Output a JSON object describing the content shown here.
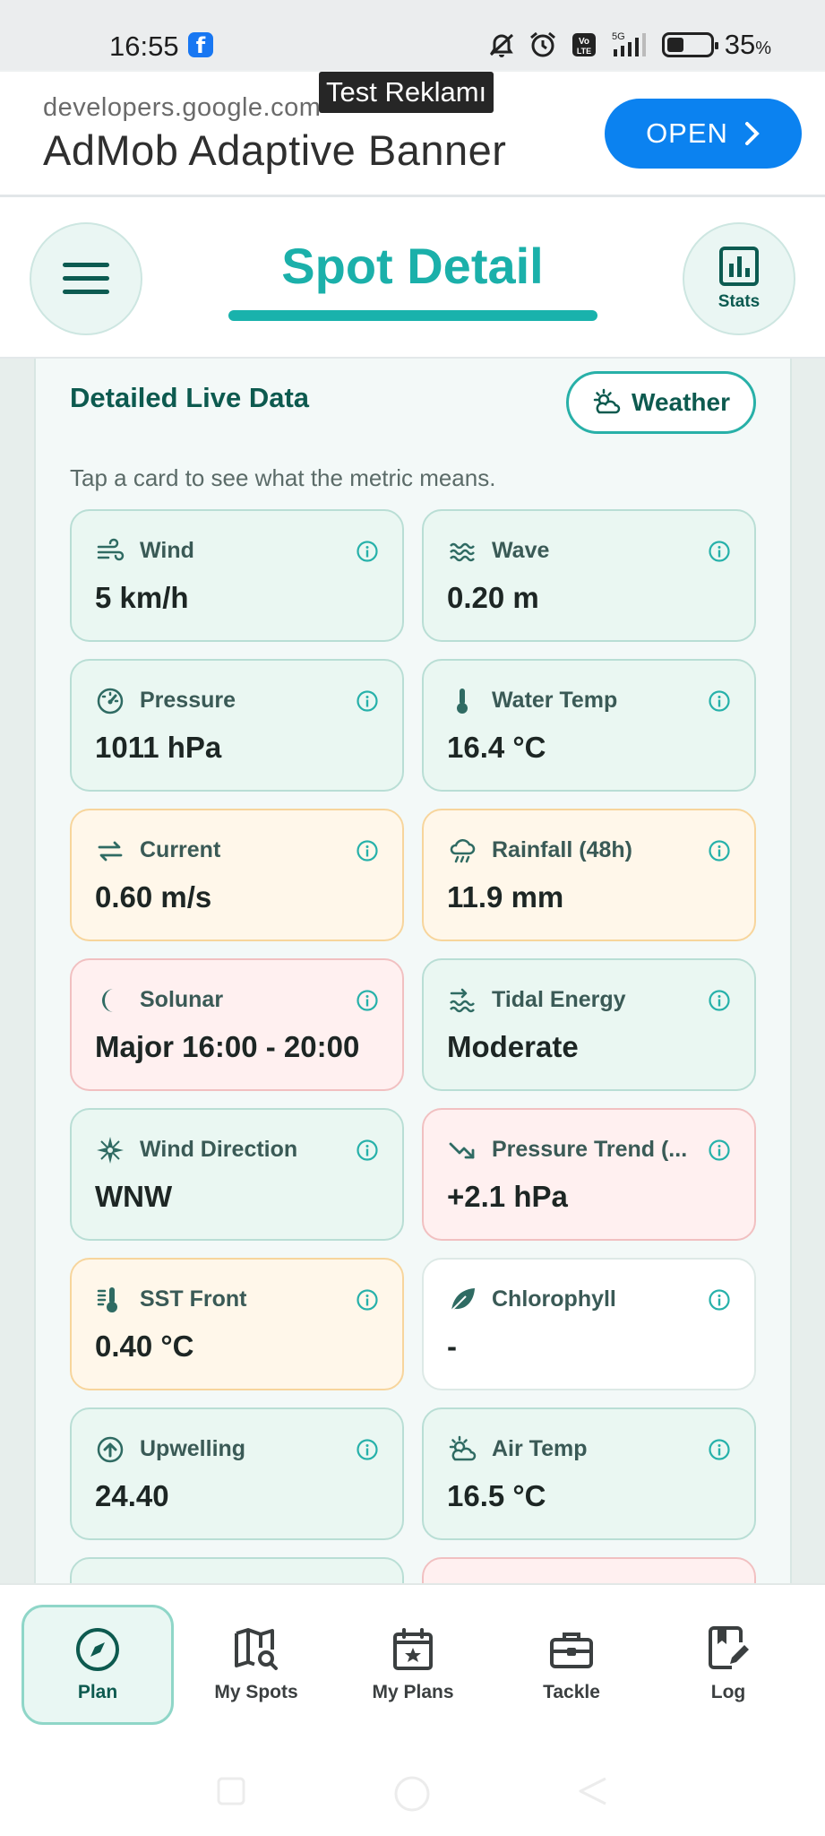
{
  "status_bar": {
    "time": "16:55",
    "app_icon": "facebook-icon",
    "battery_percent": "35",
    "battery_unit": "%",
    "battery_level": 0.35,
    "indicators": [
      "mute-icon",
      "alarm-icon",
      "volte-icon",
      "signal-5g-icon",
      "battery-icon"
    ]
  },
  "ad": {
    "label": "Test Reklamı",
    "source": "developers.google.com",
    "title": "AdMob Adaptive Banner",
    "cta": "OPEN"
  },
  "header": {
    "title": "Spot Detail",
    "menu_icon": "hamburger-icon",
    "stats_label": "Stats"
  },
  "panel": {
    "title": "Detailed Live Data",
    "weather_button": "Weather",
    "hint": "Tap a card to see what the metric means."
  },
  "cards": [
    {
      "label": "Wind",
      "value": "5 km/h",
      "icon": "wind-icon",
      "tone": "green"
    },
    {
      "label": "Wave",
      "value": "0.20 m",
      "icon": "wave-icon",
      "tone": "green"
    },
    {
      "label": "Pressure",
      "value": "1011 hPa",
      "icon": "gauge-icon",
      "tone": "green"
    },
    {
      "label": "Water Temp",
      "value": "16.4 °C",
      "icon": "thermometer-icon",
      "tone": "green"
    },
    {
      "label": "Current",
      "value": "0.60 m/s",
      "icon": "swap-arrows-icon",
      "tone": "orange"
    },
    {
      "label": "Rainfall (48h)",
      "value": "11.9 mm",
      "icon": "rain-cloud-icon",
      "tone": "orange"
    },
    {
      "label": "Solunar",
      "value": "Major 16:00 - 20:00",
      "icon": "moon-icon",
      "tone": "red"
    },
    {
      "label": "Tidal Energy",
      "value": "Moderate",
      "icon": "tide-icon",
      "tone": "green"
    },
    {
      "label": "Wind Direction",
      "value": "WNW",
      "icon": "compass-rose-icon",
      "tone": "green"
    },
    {
      "label": "Pressure Trend (...",
      "value": "+2.1 hPa",
      "icon": "trend-down-icon",
      "tone": "red"
    },
    {
      "label": "SST Front",
      "value": "0.40 °C",
      "icon": "thermometer-lines-icon",
      "tone": "orange"
    },
    {
      "label": "Chlorophyll",
      "value": "-",
      "icon": "leaf-icon",
      "tone": "white"
    },
    {
      "label": "Upwelling",
      "value": "24.40",
      "icon": "arrow-up-circle-icon",
      "tone": "green"
    },
    {
      "label": "Air Temp",
      "value": "16.5 °C",
      "icon": "sun-cloud-icon",
      "tone": "green"
    }
  ],
  "bottom_nav": [
    {
      "label": "Plan",
      "icon": "compass-icon",
      "active": true
    },
    {
      "label": "My Spots",
      "icon": "map-search-icon",
      "active": false
    },
    {
      "label": "My Plans",
      "icon": "calendar-star-icon",
      "active": false
    },
    {
      "label": "Tackle",
      "icon": "tackle-box-icon",
      "active": false
    },
    {
      "label": "Log",
      "icon": "notebook-edit-icon",
      "active": false
    }
  ],
  "colors": {
    "accent": "#1bb0aa",
    "dark_teal": "#0d5a4f",
    "ad_button": "#0b82f0",
    "card_green": "#eaf7f2",
    "card_orange": "#fff7ea",
    "card_red": "#fff0f0"
  }
}
